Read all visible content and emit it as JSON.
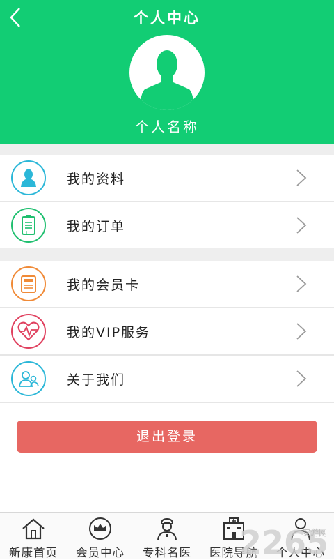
{
  "header": {
    "title": "个人中心",
    "username": "个人名称",
    "background": "#12cd74",
    "back_icon": "chevron-left-icon",
    "avatar_icon": "person-silhouette-icon"
  },
  "menu_group_1": [
    {
      "label": "我的资料",
      "icon": "profile-icon",
      "color": "#2bb7d8"
    },
    {
      "label": "我的订单",
      "icon": "order-clipboard-icon",
      "color": "#1fbf6f"
    }
  ],
  "menu_group_2": [
    {
      "label": "我的会员卡",
      "icon": "member-card-icon",
      "color": "#f08a37"
    },
    {
      "label": "我的VIP服务",
      "icon": "heartbeat-icon",
      "color": "#e0415f"
    },
    {
      "label": "关于我们",
      "icon": "about-us-icon",
      "color": "#2bb7d8"
    }
  ],
  "logout": {
    "label": "退出登录",
    "color": "#e76762"
  },
  "tabbar": [
    {
      "label": "新康首页",
      "icon": "home-icon"
    },
    {
      "label": "会员中心",
      "icon": "crown-icon"
    },
    {
      "label": "专科名医",
      "icon": "doctor-icon"
    },
    {
      "label": "医院导航",
      "icon": "hospital-icon"
    },
    {
      "label": "个人中心",
      "icon": "person-icon"
    }
  ],
  "watermark": {
    "text": "2265",
    "suffix": "安游网"
  }
}
